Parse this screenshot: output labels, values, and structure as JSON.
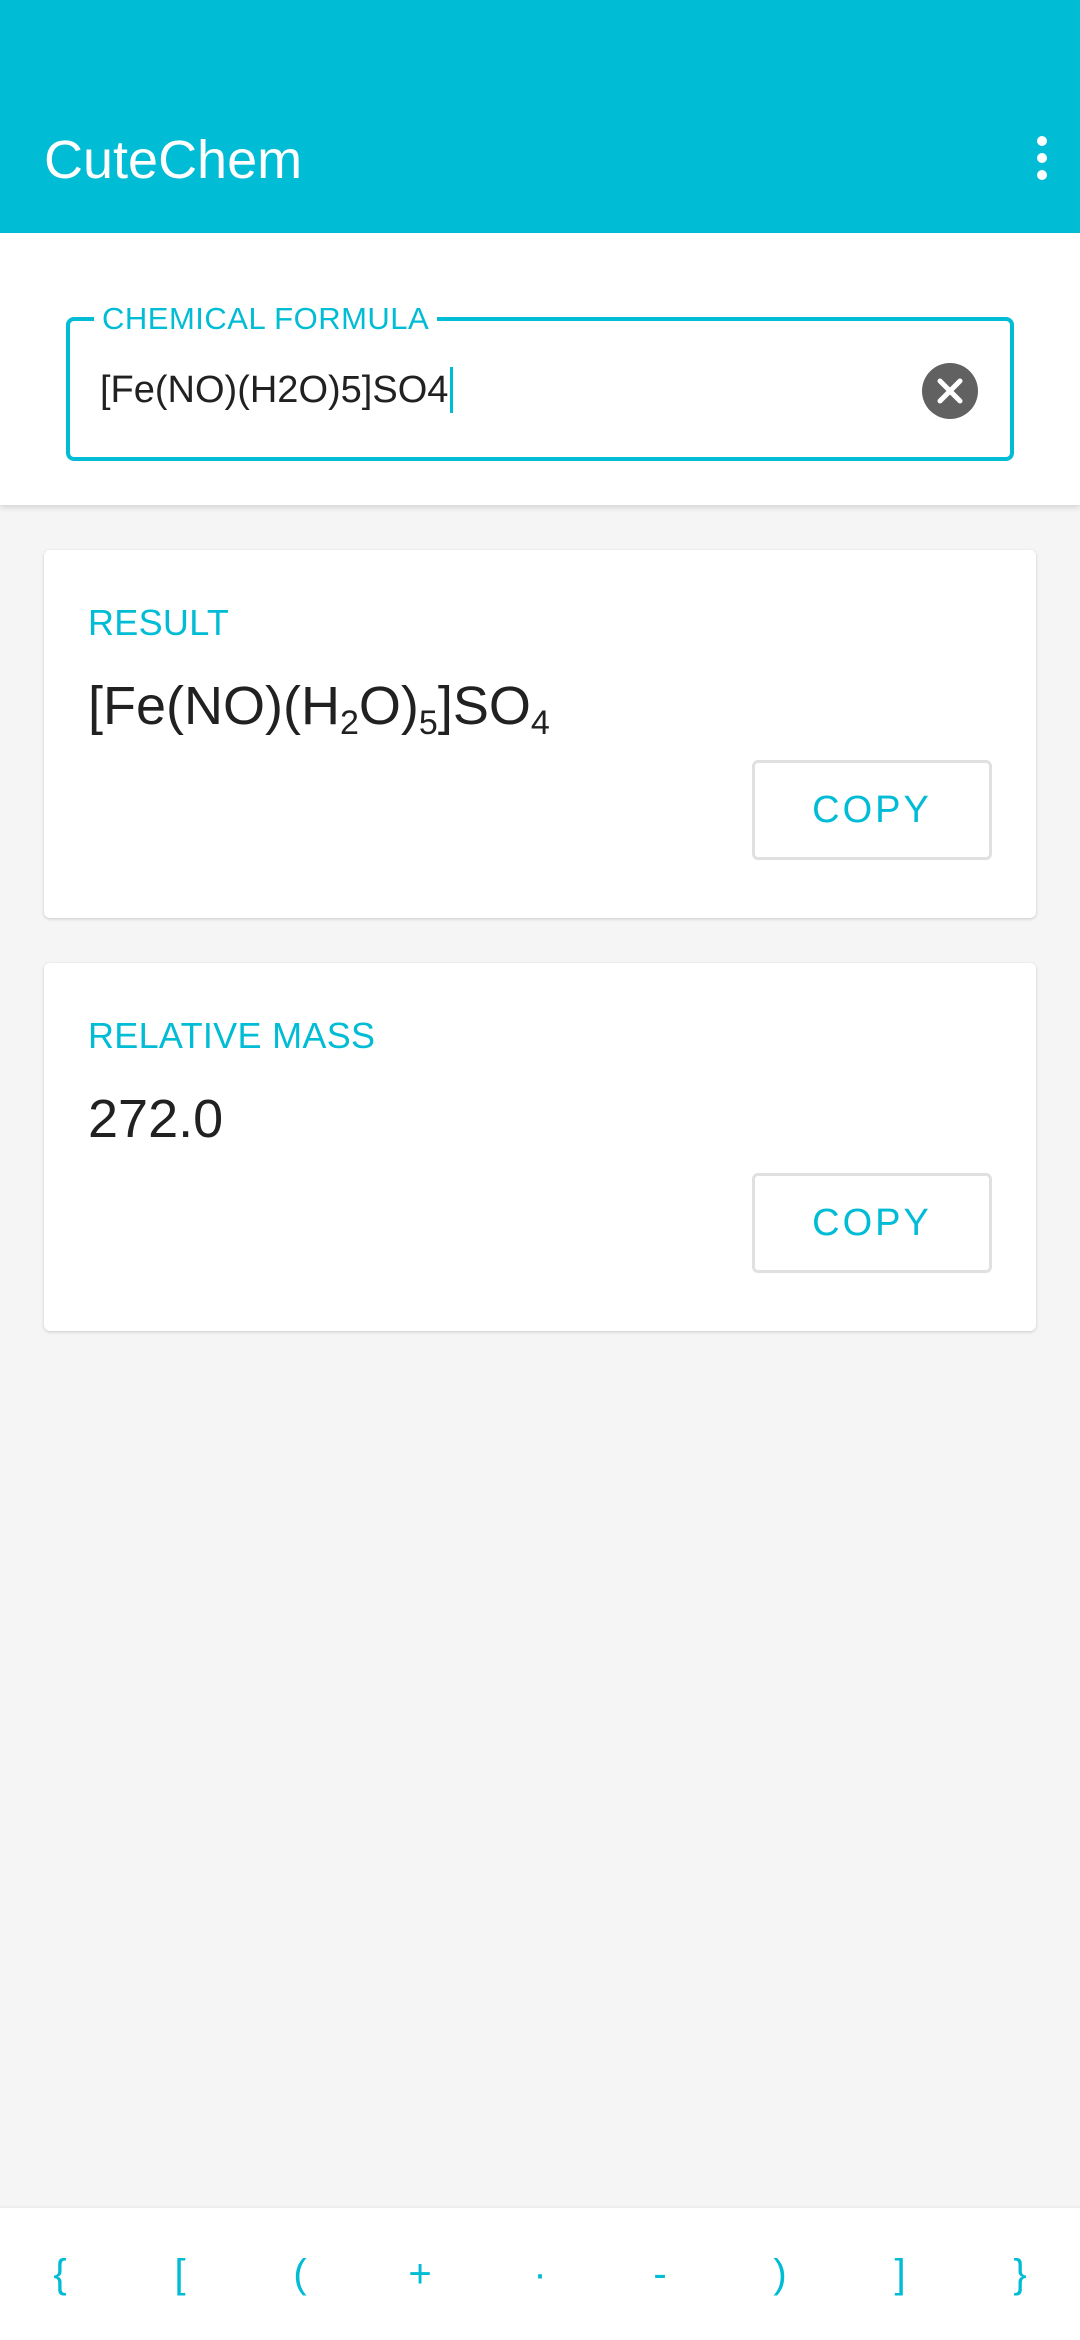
{
  "appbar": {
    "title": "CuteChem",
    "menu_icon": "more-vert-icon"
  },
  "input": {
    "label": "CHEMICAL FORMULA",
    "value": "[Fe(NO)(H2O)5]SO4",
    "clear_icon": "clear-circle-icon"
  },
  "result": {
    "label": "RESULT",
    "formula_parts": {
      "p1": "[Fe(NO)(H",
      "s1": "2",
      "p2": "O)",
      "s2": "5",
      "p3": "]SO",
      "s3": "4"
    },
    "copy_label": "COPY"
  },
  "mass": {
    "label": "RELATIVE MASS",
    "value": "272.0",
    "copy_label": "COPY"
  },
  "symbols": [
    "{",
    "[",
    "(",
    "+",
    "·",
    "-",
    ")",
    "]",
    "}"
  ],
  "colors": {
    "accent": "#00bcd4",
    "text": "#212121",
    "background": "#f5f5f5"
  }
}
